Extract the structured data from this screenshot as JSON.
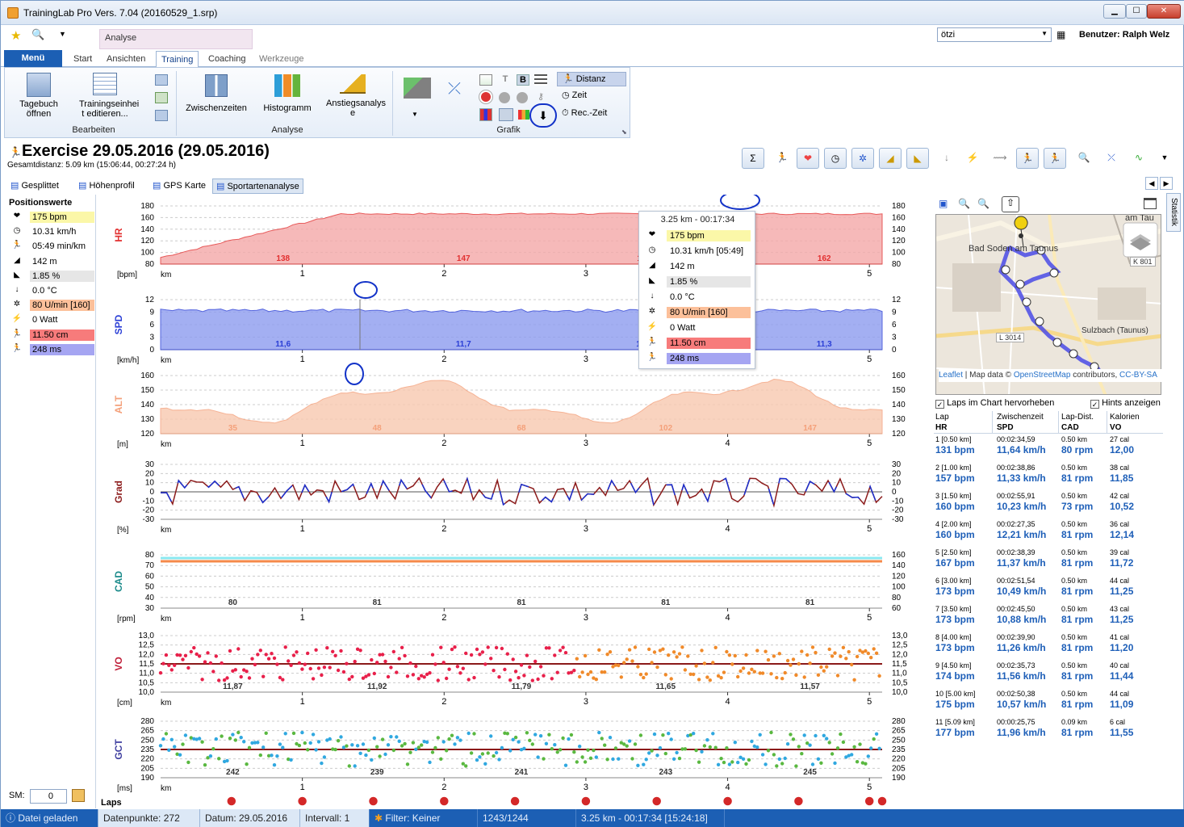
{
  "window": {
    "title": "TrainingLab Pro Vers. 7.04 (20160529_1.srp)",
    "controls": [
      "▁",
      "☐",
      "✕"
    ]
  },
  "context_group": "Analyse",
  "ribbon_tabs": [
    "Start",
    "Ansichten",
    "Training",
    "Coaching",
    "Werkzeuge"
  ],
  "menu_label": "Menü",
  "ribbon": {
    "bearbeiten": {
      "label": "Bearbeiten",
      "tagebuch": "Tagebuch öffnen",
      "trainingseinheit": "Trainingseinhei t editieren..."
    },
    "analyse": {
      "label": "Analyse",
      "zwischenzeiten": "Zwischenzeiten",
      "histogramm": "Histogramm",
      "anstieg": "Anstiegsanalys e"
    },
    "grafik": {
      "label": "Grafik",
      "distanz": "Distanz",
      "zeit": "Zeit",
      "reczeit": "Rec.-Zeit"
    }
  },
  "user": {
    "dropdown_value": "ötzi",
    "label": "Benutzer: Ralph Welz"
  },
  "exercise": {
    "title": "Exercise 29.05.2016 (29.05.2016)",
    "subtitle": "Gesamtdistanz: 5.09 km (15:06:44, 00:27:24 h)"
  },
  "view_tabs": [
    "Gesplittet",
    "Höhenprofil",
    "GPS Karte",
    "Sportartenanalyse"
  ],
  "positions": {
    "heading": "Positionswerte",
    "items": [
      {
        "icon": "heart-icon",
        "glyph": "❤",
        "value": "175 bpm",
        "color": "#fbf7a8"
      },
      {
        "icon": "speedometer-icon",
        "glyph": "◷",
        "value": "10.31 km/h",
        "color": ""
      },
      {
        "icon": "runner-icon",
        "glyph": "🏃",
        "value": "05:49 min/km",
        "color": ""
      },
      {
        "icon": "altitude-icon",
        "glyph": "◢",
        "value": "142 m",
        "color": ""
      },
      {
        "icon": "gradient-icon",
        "glyph": "◣",
        "value": "1.85 %",
        "color": "#e6e6e6"
      },
      {
        "icon": "temperature-icon",
        "glyph": "↓",
        "value": "0.0 °C",
        "color": ""
      },
      {
        "icon": "cadence-icon",
        "glyph": "✲",
        "value": "80 U/min [160]",
        "color": "#fcc09a"
      },
      {
        "icon": "power-icon",
        "glyph": "⚡",
        "value": "0 Watt",
        "color": ""
      },
      {
        "icon": "vertical-oscillation-icon",
        "glyph": "🏃",
        "value": "11.50 cm",
        "color": "#f77b7b"
      },
      {
        "icon": "ground-contact-icon",
        "glyph": "🏃",
        "value": "248 ms",
        "color": "#a5a5f2"
      }
    ],
    "sm_label": "SM:",
    "sm_value": "0"
  },
  "tooltip": {
    "header": "3.25 km - 00:17:34",
    "items": [
      {
        "glyph": "❤",
        "value": "175 bpm",
        "color": "#fbf7a8"
      },
      {
        "glyph": "◷",
        "value": "10.31 km/h [05:49]",
        "color": ""
      },
      {
        "glyph": "◢",
        "value": "142 m",
        "color": ""
      },
      {
        "glyph": "◣",
        "value": "1.85 %",
        "color": "#e6e6e6"
      },
      {
        "glyph": "↓",
        "value": "0.0 °C",
        "color": ""
      },
      {
        "glyph": "✲",
        "value": "80 U/min [160]",
        "color": "#fcc09a"
      },
      {
        "glyph": "⚡",
        "value": "0 Watt",
        "color": ""
      },
      {
        "glyph": "🏃",
        "value": "11.50 cm",
        "color": "#f77b7b"
      },
      {
        "glyph": "🏃",
        "value": "248 ms",
        "color": "#a5a5f2"
      }
    ]
  },
  "charts": [
    {
      "name": "hr",
      "label": "HR",
      "unit": "[bpm]",
      "color": "#e23030",
      "ticks": [
        "180",
        "160",
        "140",
        "120",
        "100",
        "80"
      ],
      "rticks": [
        "180",
        "160",
        "140",
        "120",
        "100",
        "80"
      ],
      "laps": [
        "138",
        "147",
        "154",
        "162"
      ]
    },
    {
      "name": "spd",
      "label": "SPD",
      "unit": "[km/h]",
      "color": "#2b3fd6",
      "ticks": [
        "12",
        "9",
        "6",
        "3",
        "0"
      ],
      "rticks": [
        "12",
        "9",
        "6",
        "3",
        "0"
      ],
      "laps": [
        "11,6",
        "11,7",
        "11,4",
        "11,3"
      ]
    },
    {
      "name": "alt",
      "label": "ALT",
      "unit": "[m]",
      "color": "#f4a07a",
      "ticks": [
        "160",
        "150",
        "140",
        "130",
        "120"
      ],
      "rticks": [
        "160",
        "150",
        "140",
        "130",
        "120"
      ],
      "laps": [
        "35",
        "48",
        "68",
        "102",
        "147"
      ]
    },
    {
      "name": "grad",
      "label": "Grad",
      "unit": "[%]",
      "color": "#8b1a1a",
      "ticks": [
        "30",
        "20",
        "10",
        "0",
        "-10",
        "-20",
        "-30"
      ],
      "rticks": [
        "30",
        "20",
        "10",
        "0",
        "-10",
        "-20",
        "-30"
      ],
      "laps": []
    },
    {
      "name": "cad",
      "label": "CAD",
      "unit": "[rpm]",
      "color": "#1a8a8a",
      "ticks": [
        "80",
        "70",
        "60",
        "50",
        "40",
        "30"
      ],
      "rticks": [
        "160",
        "140",
        "120",
        "100",
        "80",
        "60"
      ],
      "laps": [
        "80",
        "81",
        "81",
        "81",
        "81"
      ]
    },
    {
      "name": "vo",
      "label": "VO",
      "unit": "[cm]",
      "color": "#c0203a",
      "ticks": [
        "13,0",
        "12,5",
        "12,0",
        "11,5",
        "11,0",
        "10,5",
        "10,0"
      ],
      "rticks": [
        "13,0",
        "12,5",
        "12,0",
        "11,5",
        "11,0",
        "10,5",
        "10,0"
      ],
      "laps": [
        "11,87",
        "11,92",
        "11,79",
        "11,65",
        "11,57"
      ]
    },
    {
      "name": "gct",
      "label": "GCT",
      "unit": "[ms]",
      "color": "#4040a0",
      "ticks": [
        "280",
        "265",
        "250",
        "235",
        "220",
        "205",
        "190"
      ],
      "rticks": [
        "280",
        "265",
        "250",
        "235",
        "220",
        "205",
        "190"
      ],
      "laps": [
        "242",
        "239",
        "241",
        "243",
        "245"
      ]
    }
  ],
  "x_axis": {
    "unit": "km",
    "ticks": [
      "1",
      "2",
      "3",
      "4",
      "5"
    ]
  },
  "laps_label": "Laps",
  "map": {
    "labels": [
      "Bad Soden am Taunus",
      "am Tau",
      "Sulzbach (Taunus)",
      "L 3014",
      "K 801"
    ],
    "attribution_leaflet": "Leaflet",
    "attribution_text": " | Map data © ",
    "attribution_osm": "OpenStreetMap",
    "attribution_tail": " contributors, ",
    "attribution_cc": "CC-BY-SA"
  },
  "options": {
    "laps_highlight": "Laps im Chart hervorheben",
    "hints": "Hints anzeigen"
  },
  "lap_table": {
    "headers1": [
      "Lap",
      "Zwischenzeit",
      "Lap-Dist.",
      "Kalorien"
    ],
    "headers2": [
      "HR",
      "SPD",
      "CAD",
      "VO"
    ],
    "rows": [
      {
        "lap": "1 [0.50 km]",
        "time": "00:02:34,59",
        "dist": "0.50 km",
        "cal": "27 cal",
        "hr": "131 bpm",
        "spd": "11,64 km/h",
        "cad": "80 rpm",
        "vo": "12,00"
      },
      {
        "lap": "2 [1.00 km]",
        "time": "00:02:38,86",
        "dist": "0.50 km",
        "cal": "38 cal",
        "hr": "157 bpm",
        "spd": "11,33 km/h",
        "cad": "81 rpm",
        "vo": "11,85"
      },
      {
        "lap": "3 [1.50 km]",
        "time": "00:02:55,91",
        "dist": "0.50 km",
        "cal": "42 cal",
        "hr": "160 bpm",
        "spd": "10,23 km/h",
        "cad": "73 rpm",
        "vo": "10,52"
      },
      {
        "lap": "4 [2.00 km]",
        "time": "00:02:27,35",
        "dist": "0.50 km",
        "cal": "36 cal",
        "hr": "160 bpm",
        "spd": "12,21 km/h",
        "cad": "81 rpm",
        "vo": "12,14"
      },
      {
        "lap": "5 [2.50 km]",
        "time": "00:02:38,39",
        "dist": "0.50 km",
        "cal": "39 cal",
        "hr": "167 bpm",
        "spd": "11,37 km/h",
        "cad": "81 rpm",
        "vo": "11,72"
      },
      {
        "lap": "6 [3.00 km]",
        "time": "00:02:51,54",
        "dist": "0.50 km",
        "cal": "44 cal",
        "hr": "173 bpm",
        "spd": "10,49 km/h",
        "cad": "81 rpm",
        "vo": "11,25"
      },
      {
        "lap": "7 [3.50 km]",
        "time": "00:02:45,50",
        "dist": "0.50 km",
        "cal": "43 cal",
        "hr": "173 bpm",
        "spd": "10,88 km/h",
        "cad": "81 rpm",
        "vo": "11,25"
      },
      {
        "lap": "8 [4.00 km]",
        "time": "00:02:39,90",
        "dist": "0.50 km",
        "cal": "41 cal",
        "hr": "173 bpm",
        "spd": "11,26 km/h",
        "cad": "81 rpm",
        "vo": "11,20"
      },
      {
        "lap": "9 [4.50 km]",
        "time": "00:02:35,73",
        "dist": "0.50 km",
        "cal": "40 cal",
        "hr": "174 bpm",
        "spd": "11,56 km/h",
        "cad": "81 rpm",
        "vo": "11,44"
      },
      {
        "lap": "10 [5.00 km]",
        "time": "00:02:50,38",
        "dist": "0.50 km",
        "cal": "44 cal",
        "hr": "175 bpm",
        "spd": "10,57 km/h",
        "cad": "81 rpm",
        "vo": "11,09"
      },
      {
        "lap": "11 [5.09 km]",
        "time": "00:00:25,75",
        "dist": "0.09 km",
        "cal": "6 cal",
        "hr": "177 bpm",
        "spd": "11,96 km/h",
        "cad": "81 rpm",
        "vo": "11,55"
      }
    ]
  },
  "side_tab": "Statistik",
  "status": {
    "loaded": "Datei geladen",
    "points": "Datenpunkte: 272",
    "date": "Datum: 29.05.2016",
    "interval": "Intervall: 1",
    "filter": "Filter: Keiner",
    "count": "1243/1244",
    "position": "3.25 km - 00:17:34 [15:24:18]"
  }
}
